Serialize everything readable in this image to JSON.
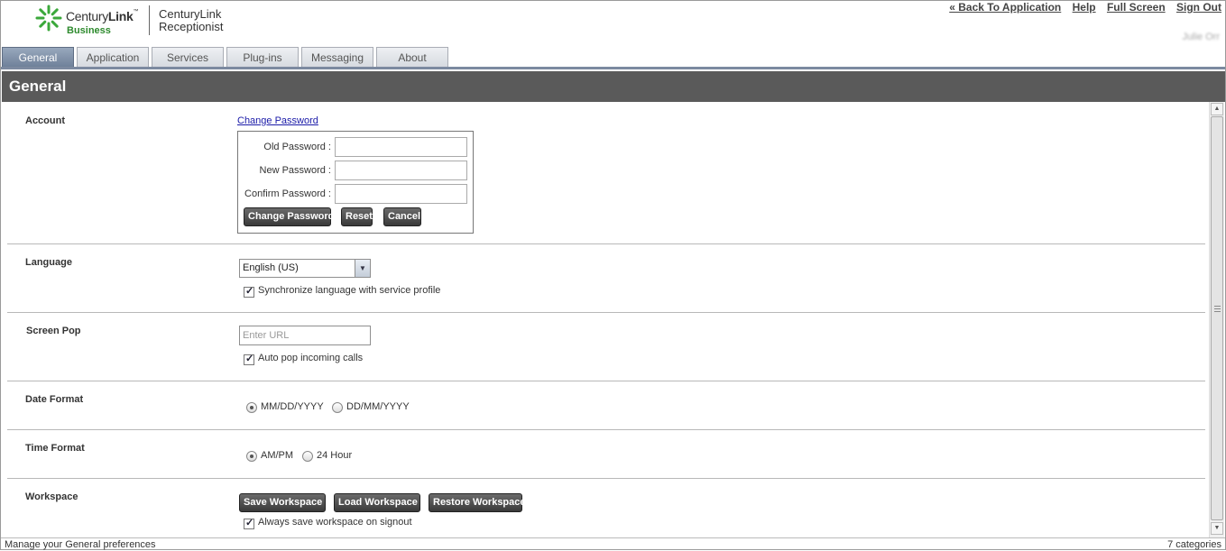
{
  "header": {
    "brand": {
      "name_light": "Century",
      "name_bold": "Link",
      "tm": "™",
      "sub": "Business"
    },
    "product": "CenturyLink Receptionist",
    "links": [
      "« Back To Application",
      "Help",
      "Full Screen",
      "Sign Out"
    ],
    "user_name": "Julie Orr"
  },
  "tabs": [
    "General",
    "Application",
    "Services",
    "Plug-ins",
    "Messaging",
    "About"
  ],
  "active_tab": "General",
  "section_title": "General",
  "account": {
    "label": "Account",
    "change_password_link": "Change Password",
    "fields": [
      {
        "label": "Old Password :",
        "value": ""
      },
      {
        "label": "New Password :",
        "value": ""
      },
      {
        "label": "Confirm Password :",
        "value": ""
      }
    ],
    "buttons": {
      "change": "Change Password",
      "reset": "Reset",
      "cancel": "Cancel"
    }
  },
  "language": {
    "label": "Language",
    "selected": "English (US)",
    "sync_label": "Synchronize language with service profile",
    "sync_checked": true
  },
  "screen_pop": {
    "label": "Screen Pop",
    "url_placeholder": "Enter URL",
    "auto_pop_label": "Auto pop incoming calls",
    "auto_pop_checked": true
  },
  "date_format": {
    "label": "Date Format",
    "options": [
      "MM/DD/YYYY",
      "DD/MM/YYYY"
    ],
    "selected": "MM/DD/YYYY"
  },
  "time_format": {
    "label": "Time Format",
    "options": [
      "AM/PM",
      "24 Hour"
    ],
    "selected": "AM/PM"
  },
  "workspace": {
    "label": "Workspace",
    "buttons": {
      "save": "Save Workspace",
      "load": "Load Workspace",
      "restore": "Restore Workspace"
    },
    "always_save_label": "Always save workspace on signout",
    "always_save_checked": true
  },
  "status_bar": {
    "left": "Manage your General preferences",
    "right": "7 categories"
  },
  "colors": {
    "section_bar": "#5a5a5a",
    "active_tab": "#7c8aa0",
    "brand_green": "#2d8a2d",
    "button": "#3a3a3a"
  }
}
